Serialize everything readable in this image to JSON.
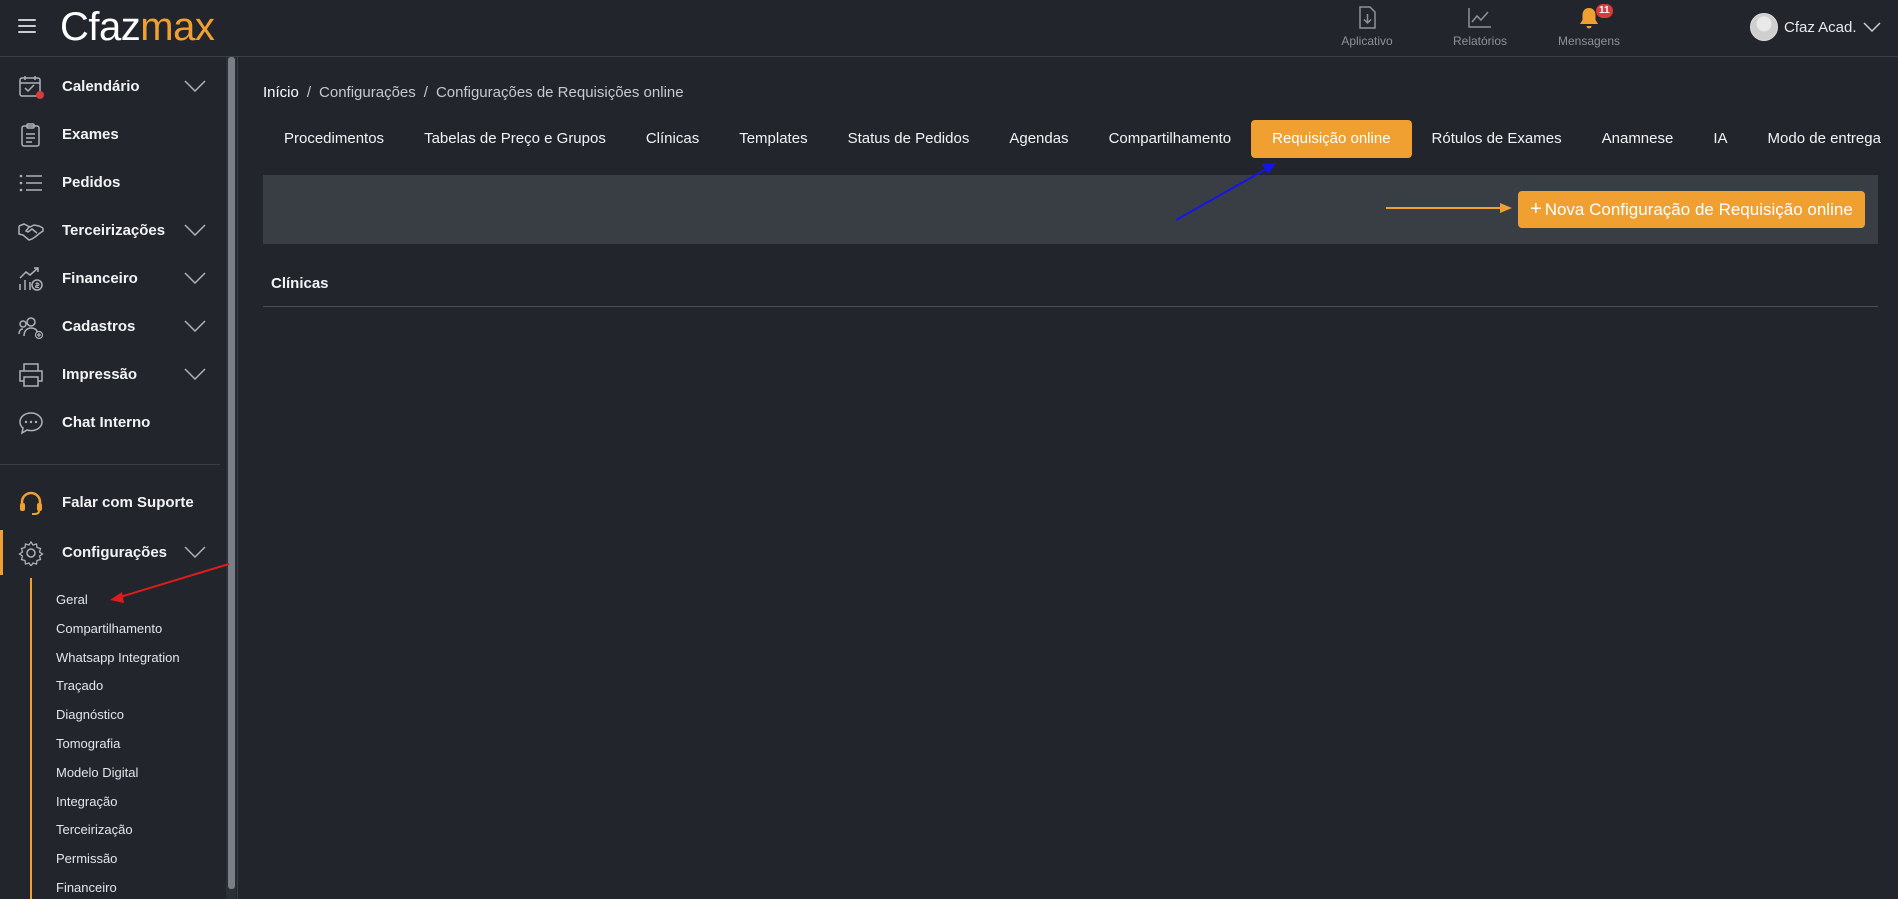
{
  "app": {
    "logo_part1": "Cfaz",
    "logo_part2": "max",
    "brand_color": "#f0a031"
  },
  "top_actions": [
    {
      "label": "Aplicativo",
      "icon": "download-icon"
    },
    {
      "label": "Relatórios",
      "icon": "chart-line-icon"
    },
    {
      "label": "Mensagens",
      "icon": "bell-icon",
      "badge": "11"
    }
  ],
  "user": {
    "name": "Cfaz Acad."
  },
  "sidebar": {
    "items": [
      {
        "label": "Calendário",
        "icon": "calendar-icon",
        "expandable": true
      },
      {
        "label": "Exames",
        "icon": "clipboard-icon",
        "expandable": false
      },
      {
        "label": "Pedidos",
        "icon": "list-icon",
        "expandable": false
      },
      {
        "label": "Terceirizações",
        "icon": "handshake-icon",
        "expandable": true
      },
      {
        "label": "Financeiro",
        "icon": "finance-icon",
        "expandable": true
      },
      {
        "label": "Cadastros",
        "icon": "users-icon",
        "expandable": true
      },
      {
        "label": "Impressão",
        "icon": "printer-icon",
        "expandable": true
      },
      {
        "label": "Chat Interno",
        "icon": "chat-icon",
        "expandable": false
      }
    ],
    "support": {
      "label": "Falar com Suporte",
      "icon": "headset-icon"
    },
    "config": {
      "label": "Configurações",
      "icon": "gear-icon"
    },
    "config_subitems": [
      "Geral",
      "Compartilhamento",
      "Whatsapp Integration",
      "Traçado",
      "Diagnóstico",
      "Tomografia",
      "Modelo Digital",
      "Integração",
      "Terceirização",
      "Permissão",
      "Financeiro"
    ]
  },
  "breadcrumb": {
    "home": "Início",
    "level1": "Configurações",
    "current": "Configurações de Requisições online",
    "separator": "/"
  },
  "tabs": [
    "Procedimentos",
    "Tabelas de Preço e Grupos",
    "Clínicas",
    "Templates",
    "Status de Pedidos",
    "Agendas",
    "Compartilhamento",
    "Requisição online",
    "Rótulos de Exames",
    "Anamnese",
    "IA",
    "Modo de entrega"
  ],
  "active_tab": "Requisição online",
  "toolbar": {
    "new_button_plus": "+",
    "new_button_label": "Nova Configuração de Requisição online"
  },
  "section": {
    "title": "Clínicas"
  }
}
